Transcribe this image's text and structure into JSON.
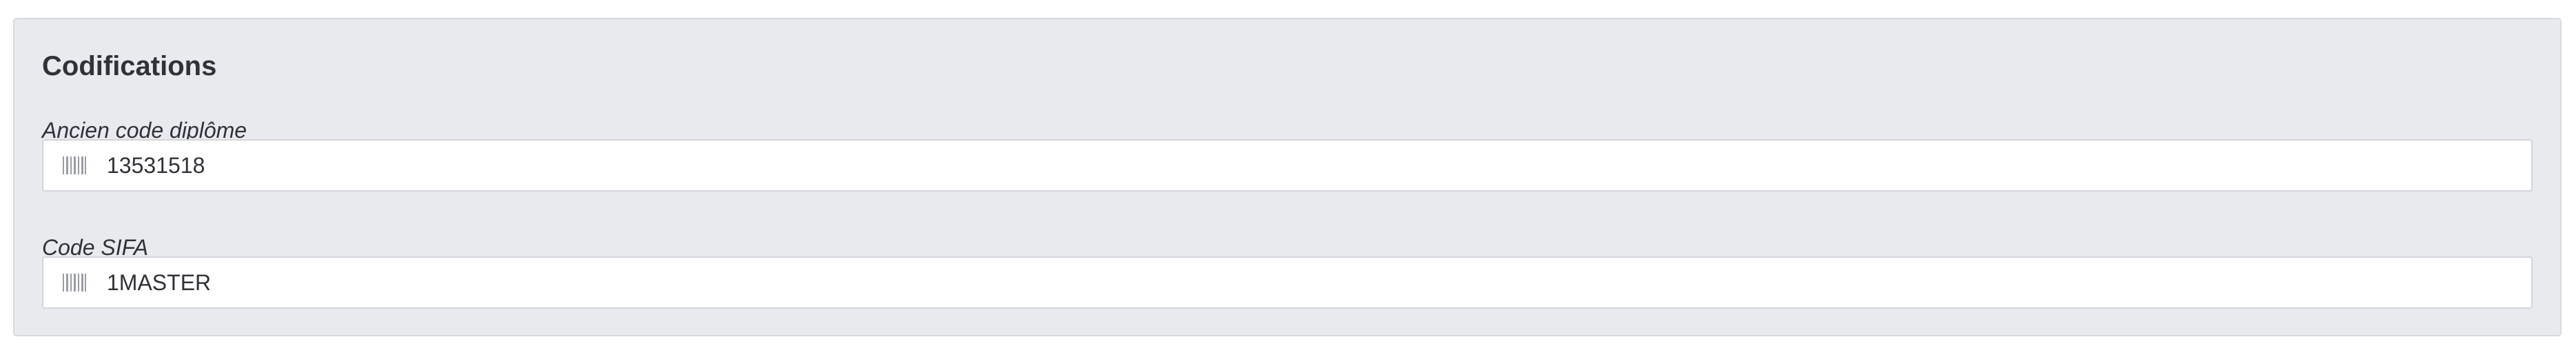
{
  "panel": {
    "title": "Codifications",
    "fields": [
      {
        "label": "Ancien code diplôme",
        "value": "13531518",
        "icon": "barcode-icon"
      },
      {
        "label": "Code SIFA",
        "value": "1MASTER",
        "icon": "barcode-icon"
      }
    ]
  },
  "colors": {
    "panel_background": "#e9eaee",
    "panel_border": "#d7d9de",
    "field_background": "#ffffff",
    "field_border": "#d2d5db",
    "text": "#2f3237",
    "icon": "#9a9da3"
  }
}
